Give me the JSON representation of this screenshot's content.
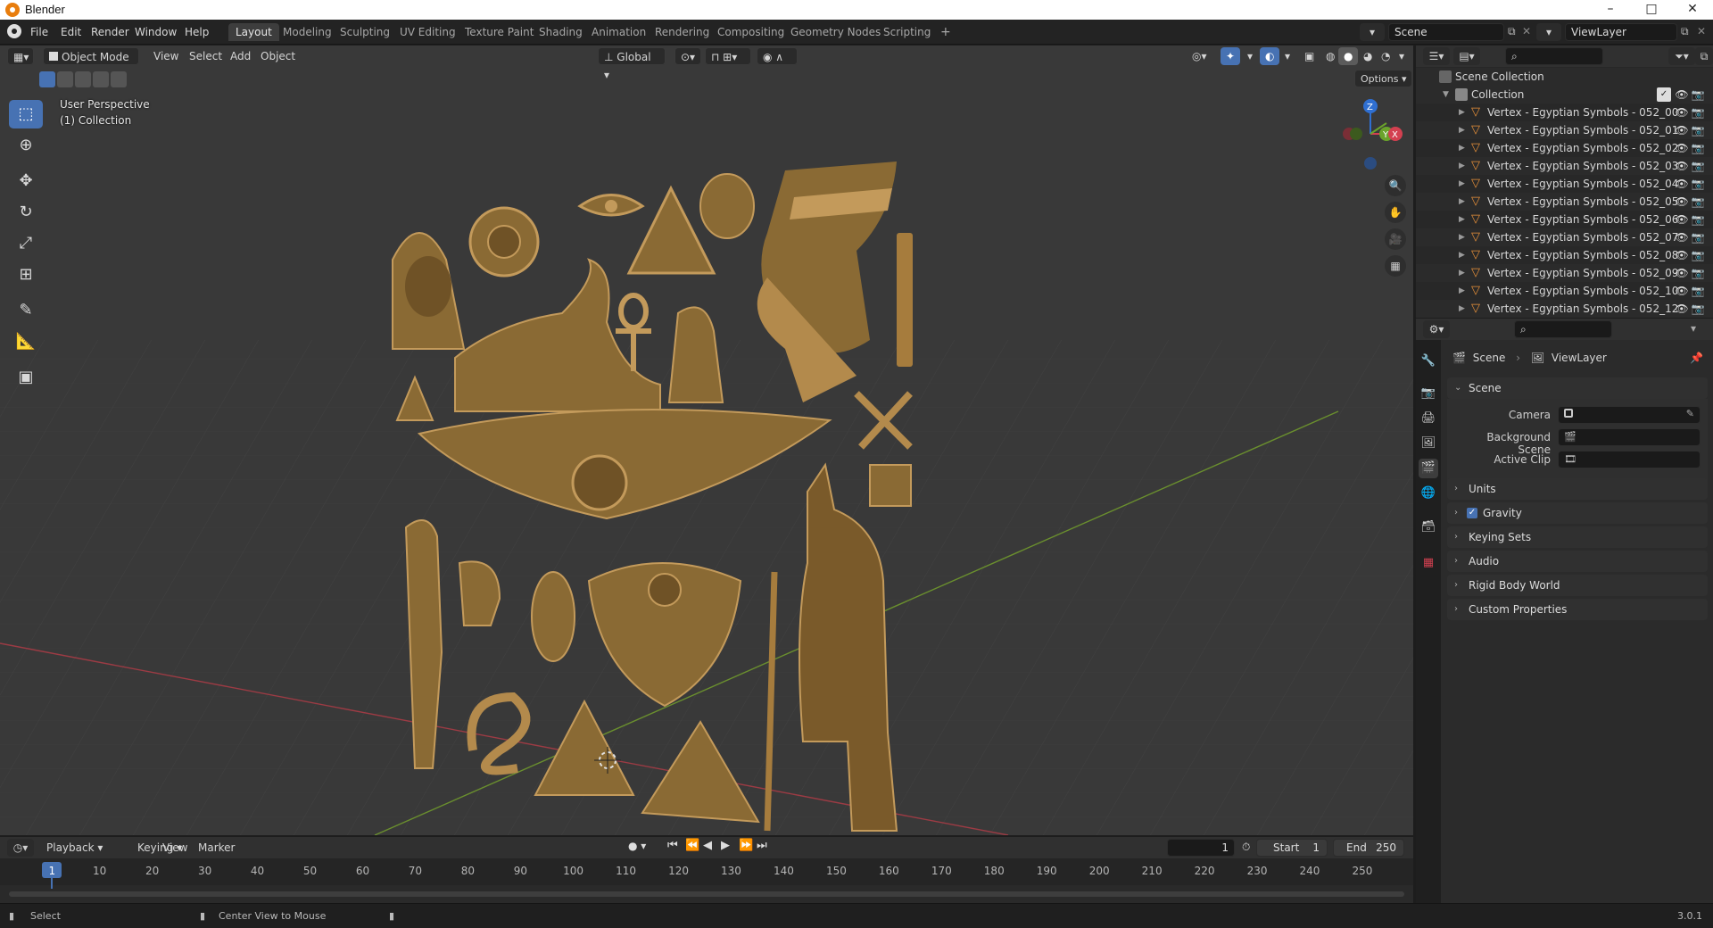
{
  "window": {
    "title": "Blender",
    "minimize": "–",
    "maximize": "□",
    "close": "✕"
  },
  "menu": {
    "items": [
      "File",
      "Edit",
      "Render",
      "Window",
      "Help"
    ]
  },
  "workspaces": {
    "tabs": [
      "Layout",
      "Modeling",
      "Sculpting",
      "UV Editing",
      "Texture Paint",
      "Shading",
      "Animation",
      "Rendering",
      "Compositing",
      "Geometry Nodes",
      "Scripting"
    ],
    "active": "Layout",
    "add": "+"
  },
  "scene_selector": {
    "value": "Scene"
  },
  "viewlayer_selector": {
    "value": "ViewLayer"
  },
  "viewport_header": {
    "mode": "Object Mode",
    "menus": [
      "View",
      "Select",
      "Add",
      "Object"
    ],
    "transform_orientation": "Global",
    "options": "Options"
  },
  "viewport_overlay": {
    "line1": "User Perspective",
    "line2": "(1) Collection"
  },
  "gizmo": {
    "z": "Z",
    "y": "Y",
    "x": "X"
  },
  "outliner": {
    "scene_collection": "Scene Collection",
    "collection": "Collection",
    "objects": [
      "Vertex - Egyptian Symbols - 052_00",
      "Vertex - Egyptian Symbols - 052_01",
      "Vertex - Egyptian Symbols - 052_02",
      "Vertex - Egyptian Symbols - 052_03",
      "Vertex - Egyptian Symbols - 052_04",
      "Vertex - Egyptian Symbols - 052_05",
      "Vertex - Egyptian Symbols - 052_06",
      "Vertex - Egyptian Symbols - 052_07",
      "Vertex - Egyptian Symbols - 052_08",
      "Vertex - Egyptian Symbols - 052_09",
      "Vertex - Egyptian Symbols - 052_10",
      "Vertex - Egyptian Symbols - 052_12"
    ]
  },
  "properties": {
    "breadcrumb_scene": "Scene",
    "breadcrumb_viewlayer": "ViewLayer",
    "scene_panel": "Scene",
    "camera_label": "Camera",
    "background_scene_label": "Background Scene",
    "active_clip_label": "Active Clip",
    "panels": [
      "Units",
      "Gravity",
      "Keying Sets",
      "Audio",
      "Rigid Body World",
      "Custom Properties"
    ],
    "gravity_checked": true
  },
  "timeline": {
    "menus": [
      "Playback",
      "Keying",
      "View",
      "Marker"
    ],
    "current_frame": "1",
    "start_label": "Start",
    "start_value": "1",
    "end_label": "End",
    "end_value": "250",
    "ruler": [
      "1",
      "10",
      "20",
      "30",
      "40",
      "50",
      "60",
      "70",
      "80",
      "90",
      "100",
      "110",
      "120",
      "130",
      "140",
      "150",
      "160",
      "170",
      "180",
      "190",
      "200",
      "210",
      "220",
      "230",
      "240",
      "250"
    ]
  },
  "statusbar": {
    "select": "Select",
    "center_view": "Center View to Mouse",
    "version": "3.0.1"
  },
  "colors": {
    "accent": "#4772b3",
    "relief_gold": "#8a6a34",
    "relief_light": "#c39a5b",
    "active_tab": "#3d3d3d"
  }
}
